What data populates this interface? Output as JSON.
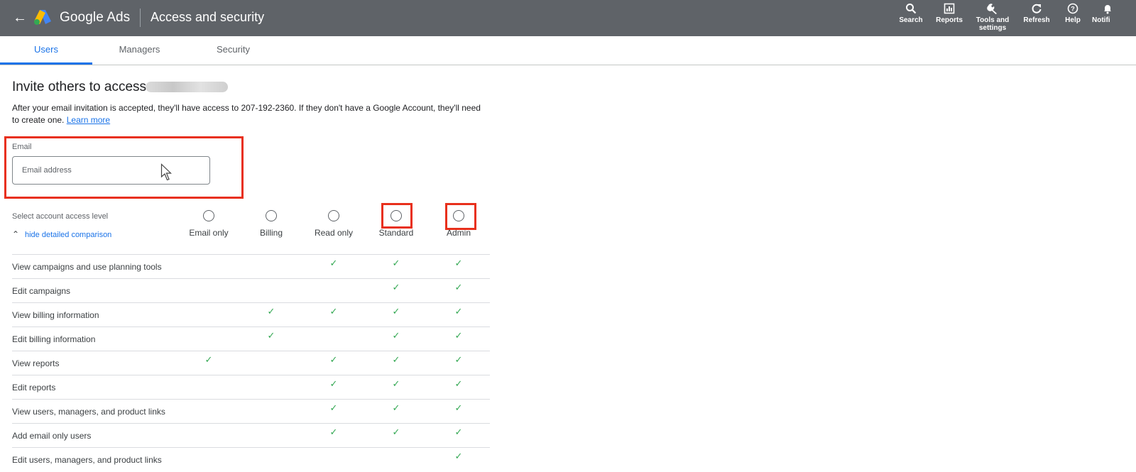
{
  "header": {
    "back_icon": "arrow-back-icon",
    "brand": "Google Ads",
    "title": "Access and security",
    "tools": [
      {
        "label": "Search",
        "icon": "search-icon"
      },
      {
        "label": "Reports",
        "icon": "reports-icon"
      },
      {
        "label": "Tools and settings",
        "icon": "wrench-icon"
      },
      {
        "label": "Refresh",
        "icon": "refresh-icon"
      },
      {
        "label": "Help",
        "icon": "help-icon"
      },
      {
        "label": "Notifi",
        "icon": "bell-icon"
      }
    ]
  },
  "tabs": [
    {
      "label": "Users",
      "active": true
    },
    {
      "label": "Managers",
      "active": false
    },
    {
      "label": "Security",
      "active": false
    }
  ],
  "invite": {
    "heading": "Invite others to access",
    "description": "After your email invitation is accepted, they'll have access to 207-192-2360. If they don't have a Google Account, they'll need to create one.",
    "learn_more": "Learn more",
    "email_label": "Email",
    "email_placeholder": "Email address",
    "email_value": ""
  },
  "access": {
    "select_label": "Select account access level",
    "toggle_link": "hide detailed comparison",
    "levels": [
      "Email only",
      "Billing",
      "Read only",
      "Standard",
      "Admin"
    ],
    "selected": null,
    "rows": [
      {
        "label": "View campaigns and use planning tools",
        "checks": [
          false,
          false,
          true,
          true,
          true
        ]
      },
      {
        "label": "Edit campaigns",
        "checks": [
          false,
          false,
          false,
          true,
          true
        ]
      },
      {
        "label": "View billing information",
        "checks": [
          false,
          true,
          true,
          true,
          true
        ]
      },
      {
        "label": "Edit billing information",
        "checks": [
          false,
          true,
          false,
          true,
          true
        ]
      },
      {
        "label": "View reports",
        "checks": [
          true,
          false,
          true,
          true,
          true
        ]
      },
      {
        "label": "Edit reports",
        "checks": [
          false,
          false,
          true,
          true,
          true
        ]
      },
      {
        "label": "View users, managers, and product links",
        "checks": [
          false,
          false,
          true,
          true,
          true
        ]
      },
      {
        "label": "Add email only users",
        "checks": [
          false,
          false,
          true,
          true,
          true
        ]
      },
      {
        "label": "Edit users, managers, and product links",
        "checks": [
          false,
          false,
          false,
          false,
          true
        ]
      }
    ]
  },
  "colors": {
    "header_bg": "#5f6368",
    "accent": "#1a73e8",
    "check": "#34a853",
    "highlight": "#e8301c"
  }
}
